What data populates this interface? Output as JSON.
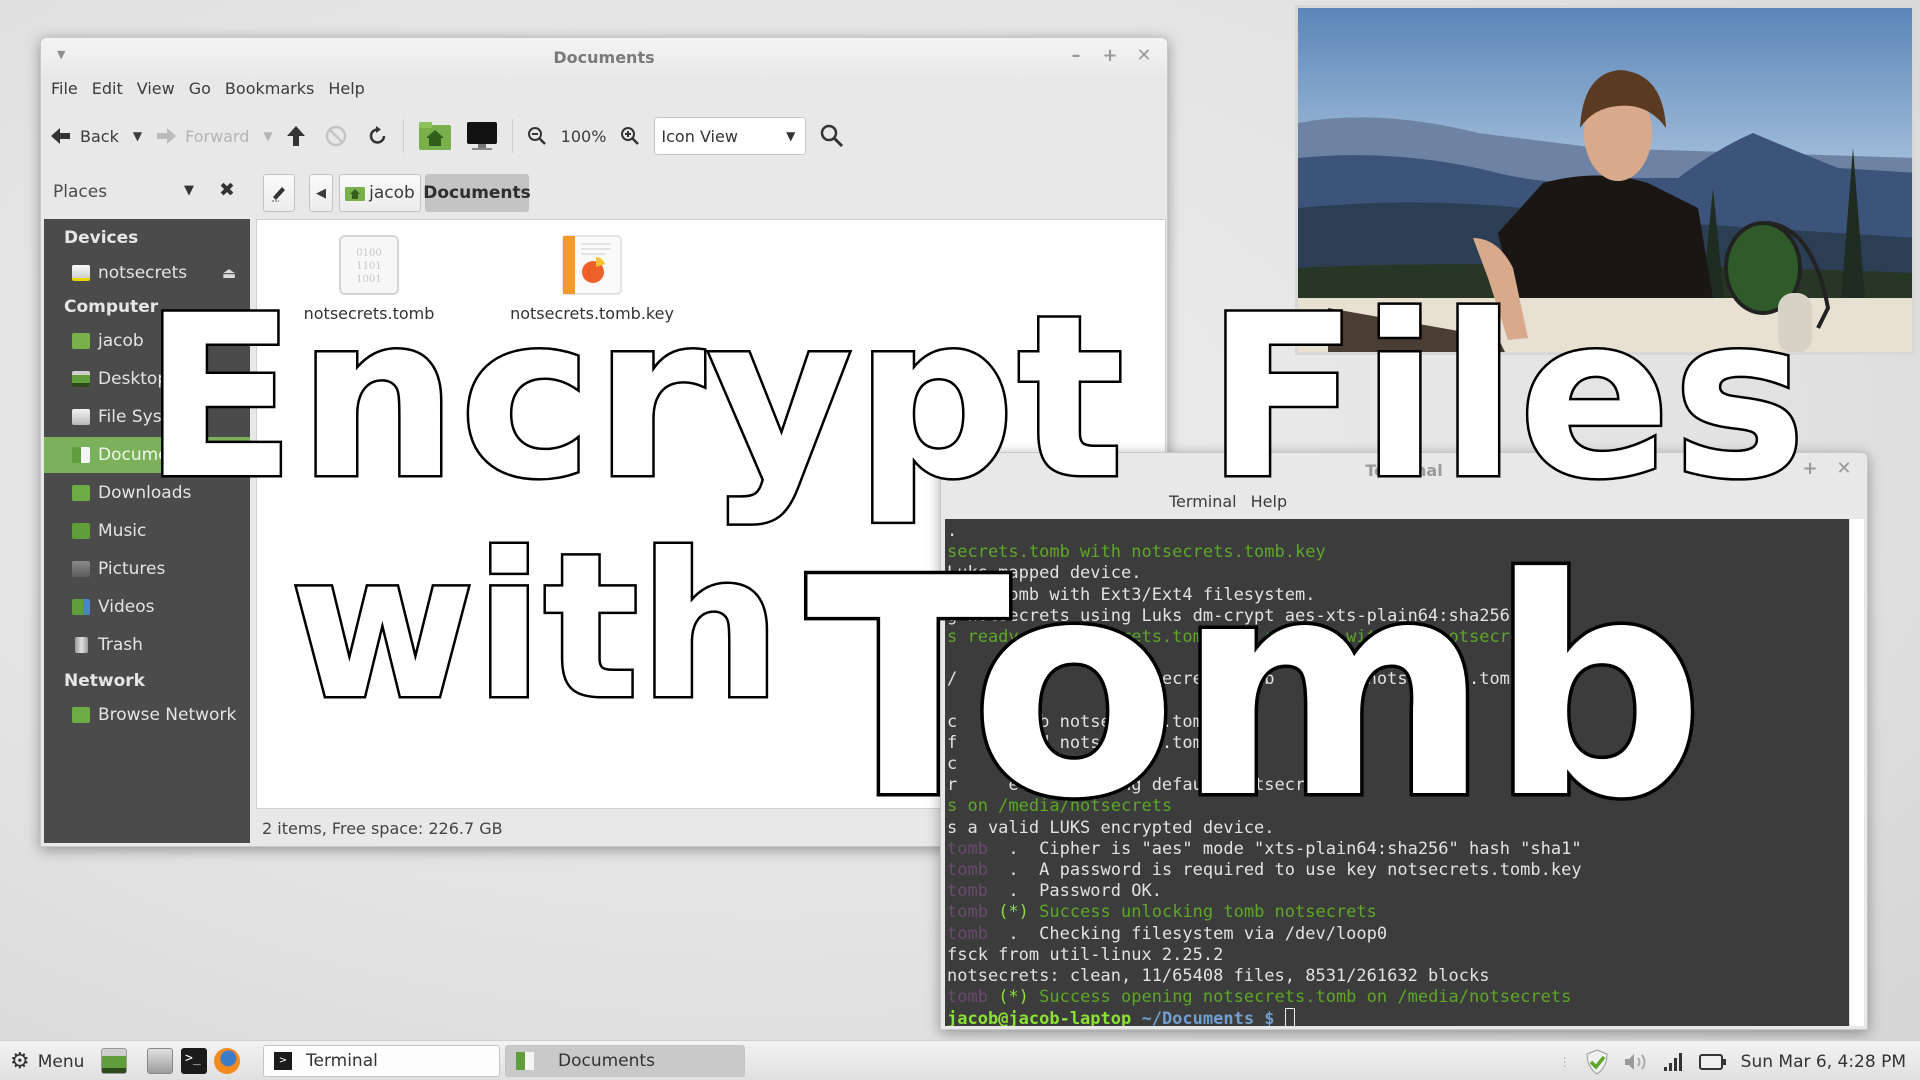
{
  "nautilus": {
    "title": "Documents",
    "menu": [
      "File",
      "Edit",
      "View",
      "Go",
      "Bookmarks",
      "Help"
    ],
    "toolbar": {
      "back": "Back",
      "forward": "Forward",
      "zoom_level": "100%",
      "view_mode": "Icon View"
    },
    "places_label": "Places",
    "breadcrumb": [
      "jacob",
      "Documents"
    ],
    "sidebar": {
      "devices_heading": "Devices",
      "devices": [
        {
          "label": "notsecrets",
          "icon": "drive-icon"
        }
      ],
      "computer_heading": "Computer",
      "computer": [
        {
          "label": "jacob",
          "icon": "home-folder-icon"
        },
        {
          "label": "Desktop",
          "icon": "desktop-icon"
        },
        {
          "label": "File System",
          "icon": "filesystem-icon"
        },
        {
          "label": "Documents",
          "icon": "documents-folder-icon",
          "selected": true
        },
        {
          "label": "Downloads",
          "icon": "downloads-folder-icon"
        },
        {
          "label": "Music",
          "icon": "music-folder-icon"
        },
        {
          "label": "Pictures",
          "icon": "pictures-folder-icon"
        },
        {
          "label": "Videos",
          "icon": "videos-folder-icon"
        },
        {
          "label": "Trash",
          "icon": "trash-icon"
        }
      ],
      "network_heading": "Network",
      "network": [
        {
          "label": "Browse Network",
          "icon": "network-icon"
        }
      ]
    },
    "files": [
      {
        "name": "notsecrets.tomb",
        "icon": "binary-file-icon"
      },
      {
        "name": "notsecrets.tomb.key",
        "icon": "presentation-file-icon"
      }
    ],
    "status": "2 items, Free space: 226.7 GB"
  },
  "terminal": {
    "title": "Terminal",
    "menu": [
      "Terminal",
      "Help"
    ],
    "lines": [
      {
        "segments": [
          {
            "t": ".",
            "c": ""
          }
        ]
      },
      {
        "segments": [
          {
            "t": "secrets.tomb with notsecrets.tomb.key",
            "c": "green"
          }
        ]
      },
      {
        "segments": [
          {
            "t": "Luks mapped device.",
            "c": ""
          }
        ]
      },
      {
        "segments": [
          {
            "t": "your Tomb with Ext3/Ext4 filesystem.",
            "c": ""
          }
        ]
      },
      {
        "segments": [
          {
            "t": "g notsecrets using Luks dm-crypt aes-xts-plain64:sha256",
            "c": ""
          }
        ]
      },
      {
        "segments": [
          {
            "t": "s ready in notsecrets.tomb and secured with key notsecrets.t",
            "c": "green"
          }
        ]
      },
      {
        "segments": [
          {
            "t": "",
            "c": ""
          }
        ]
      },
      {
        "segments": [
          {
            "t": "/                notsecrets.tomb         notsecrets.tomb.ke",
            "c": ""
          }
        ]
      },
      {
        "segments": [
          {
            "t": "",
            "c": ""
          }
        ]
      },
      {
        "segments": [
          {
            "t": "c     tomb notsecrets.tomb",
            "c": ""
          }
        ]
      },
      {
        "segments": [
          {
            "t": "f     ound notsecrets.tomb",
            "c": ""
          }
        ]
      },
      {
        "segments": [
          {
            "t": "c",
            "c": ""
          }
        ]
      },
      {
        "segments": [
          {
            "t": "r     ecified using default notsecrets",
            "c": ""
          }
        ]
      },
      {
        "segments": [
          {
            "t": "s on /media/notsecrets",
            "c": "green"
          }
        ]
      },
      {
        "segments": [
          {
            "t": "s a valid LUKS encrypted device.",
            "c": ""
          }
        ]
      },
      {
        "segments": [
          {
            "t": "tomb",
            "c": "prefix"
          },
          {
            "t": "  .  Cipher is \"aes\" mode \"xts-plain64:sha256\" hash \"sha1\"",
            "c": ""
          }
        ]
      },
      {
        "segments": [
          {
            "t": "tomb",
            "c": "prefix"
          },
          {
            "t": "  .  A password is required to use key notsecrets.tomb.key",
            "c": ""
          }
        ]
      },
      {
        "segments": [
          {
            "t": "tomb",
            "c": "prefix"
          },
          {
            "t": "  .  Password OK.",
            "c": ""
          }
        ]
      },
      {
        "segments": [
          {
            "t": "tomb",
            "c": "prefix"
          },
          {
            "t": " (*) ",
            "c": "brightgreen"
          },
          {
            "t": "Success unlocking tomb notsecrets",
            "c": "green"
          }
        ]
      },
      {
        "segments": [
          {
            "t": "tomb",
            "c": "prefix"
          },
          {
            "t": "  .  Checking filesystem via /dev/loop0",
            "c": ""
          }
        ]
      },
      {
        "segments": [
          {
            "t": "fsck from util-linux 2.25.2",
            "c": ""
          }
        ]
      },
      {
        "segments": [
          {
            "t": "notsecrets: clean, 11/65408 files, 8531/261632 blocks",
            "c": ""
          }
        ]
      },
      {
        "segments": [
          {
            "t": "tomb",
            "c": "prefix"
          },
          {
            "t": " (*) ",
            "c": "brightgreen"
          },
          {
            "t": "Success opening notsecrets.tomb on /media/notsecrets",
            "c": "green"
          }
        ]
      }
    ],
    "prompt_user": "jacob@jacob-laptop",
    "prompt_path": " ~/Documents $ "
  },
  "overlay": {
    "line1": "Encrypt Files",
    "line2a": "with",
    "line2b": "Tomb"
  },
  "taskbar": {
    "menu_label": "Menu",
    "windows": [
      {
        "label": "Terminal",
        "active": false
      },
      {
        "label": "Documents",
        "active": true
      }
    ],
    "clock": "Sun Mar 6,  4:28 PM"
  },
  "colors": {
    "sidebar_bg": "#4b4b4b",
    "sidebar_selected": "#7bb15a",
    "terminal_bg": "#3c3c3c",
    "terminal_green": "#5da828",
    "terminal_prefix": "#6a4b6e"
  }
}
